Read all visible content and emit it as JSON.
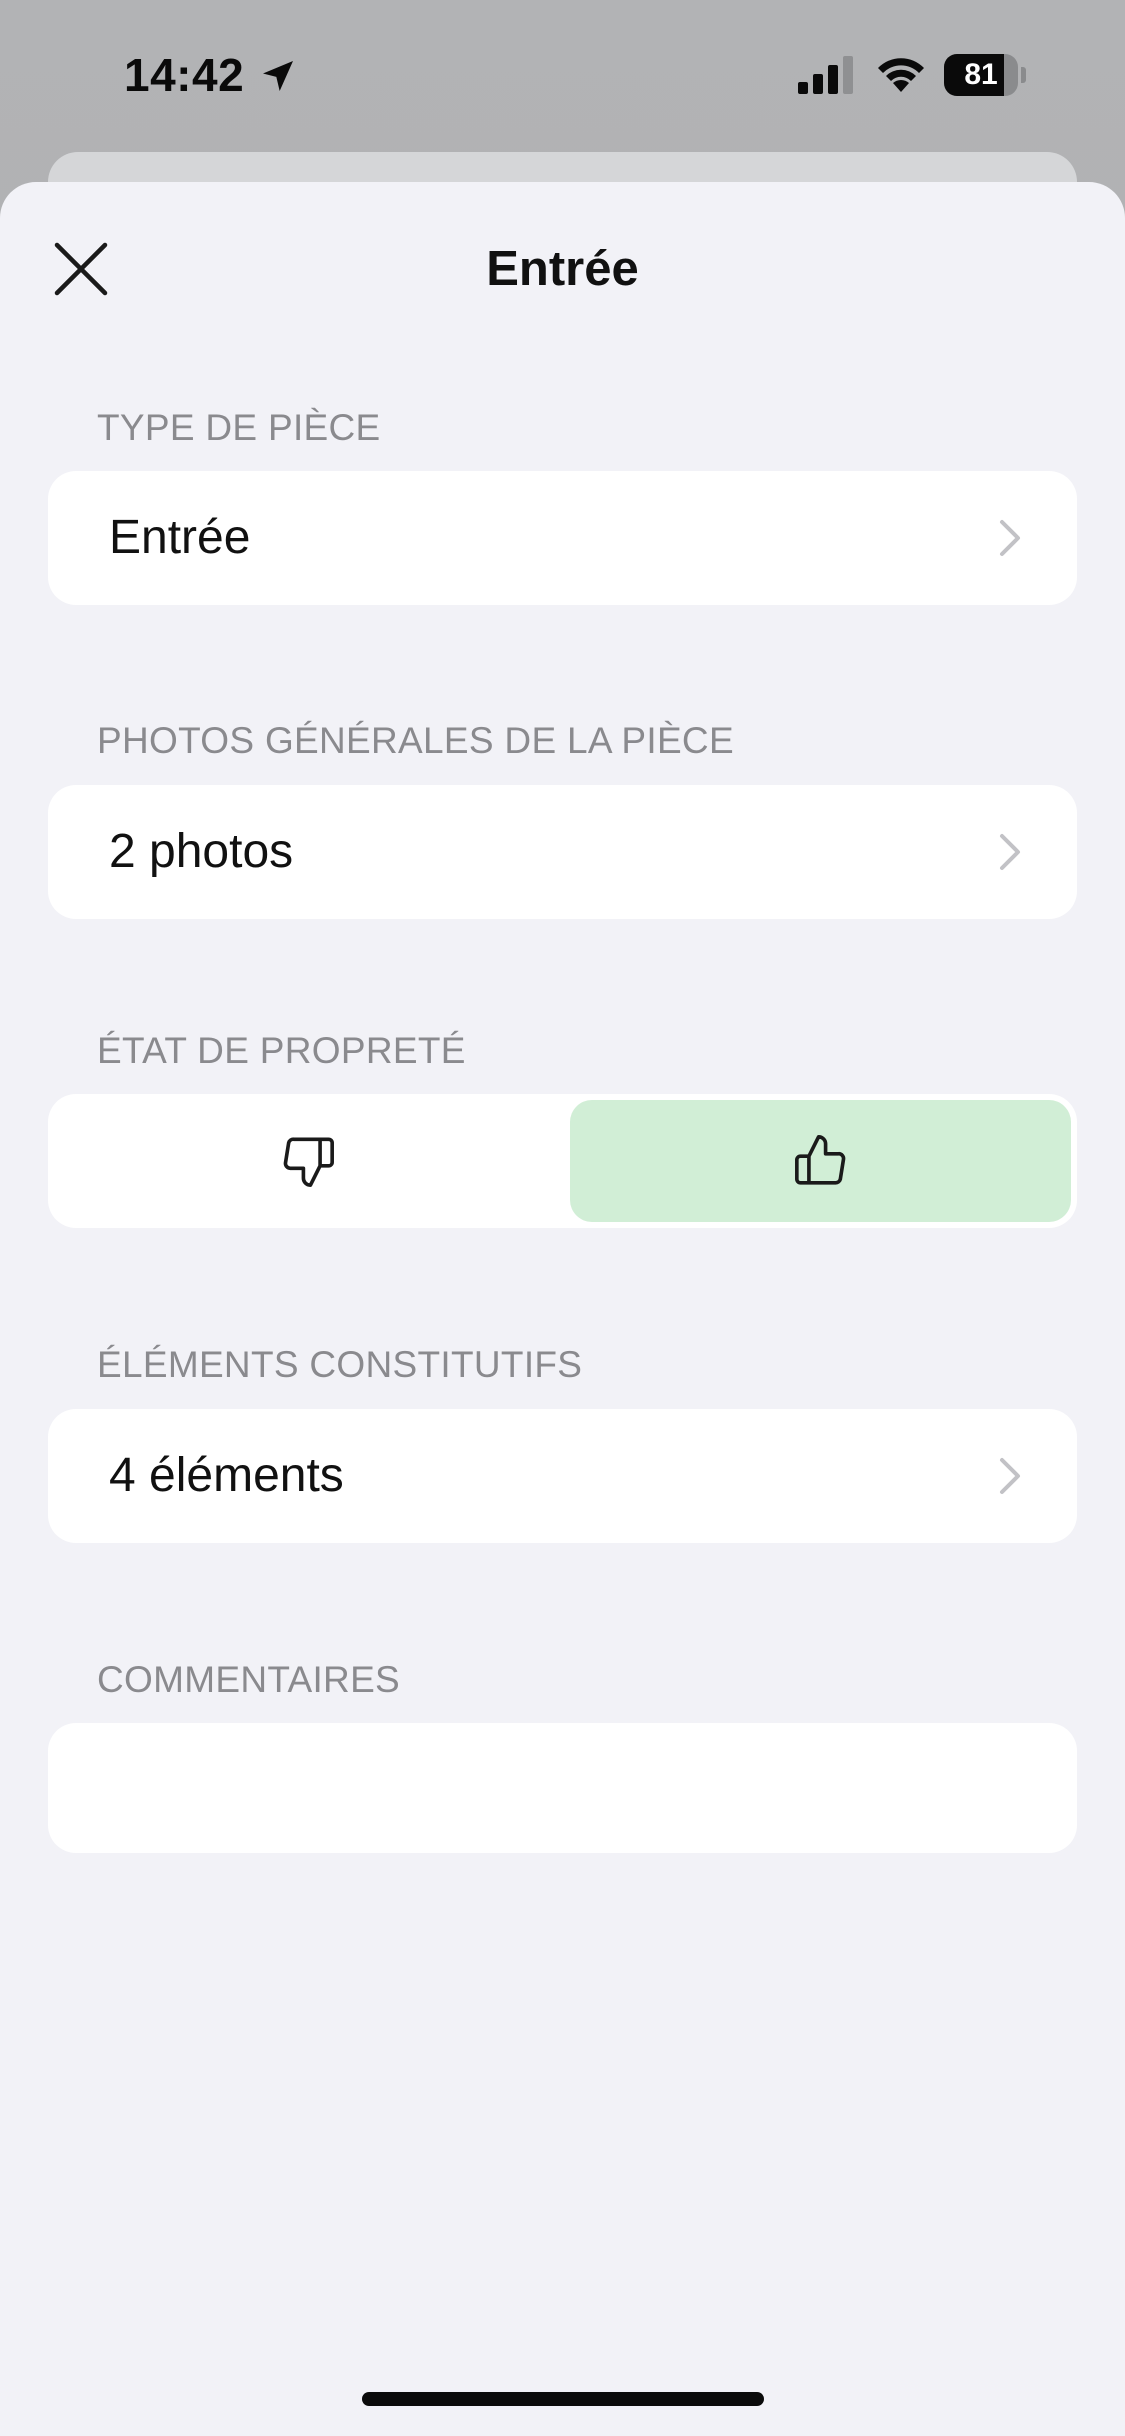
{
  "status_bar": {
    "time": "14:42",
    "battery_level": "81",
    "battery_fraction": 0.81
  },
  "header": {
    "title": "Entrée",
    "close_icon": "close-icon"
  },
  "sections": {
    "room_type": {
      "label": "TYPE DE PIÈCE",
      "value": "Entrée"
    },
    "photos": {
      "label": "PHOTOS GÉNÉRALES DE LA PIÈCE",
      "value": "2 photos"
    },
    "cleanliness": {
      "label": "ÉTAT DE PROPRETÉ",
      "options": [
        "thumbs-down-icon",
        "thumbs-up-icon"
      ],
      "selected": "thumbs-up-icon",
      "selected_color": "#d1eed6"
    },
    "elements": {
      "label": "ÉLÉMENTS CONSTITUTIFS",
      "value": "4 éléments"
    },
    "comments": {
      "label": "COMMENTAIRES",
      "value": ""
    }
  },
  "colors": {
    "sheet_background": "#f2f2f7",
    "card_background": "#ffffff",
    "section_label": "#8a8a8e",
    "selected_option": "#d1eed6"
  }
}
